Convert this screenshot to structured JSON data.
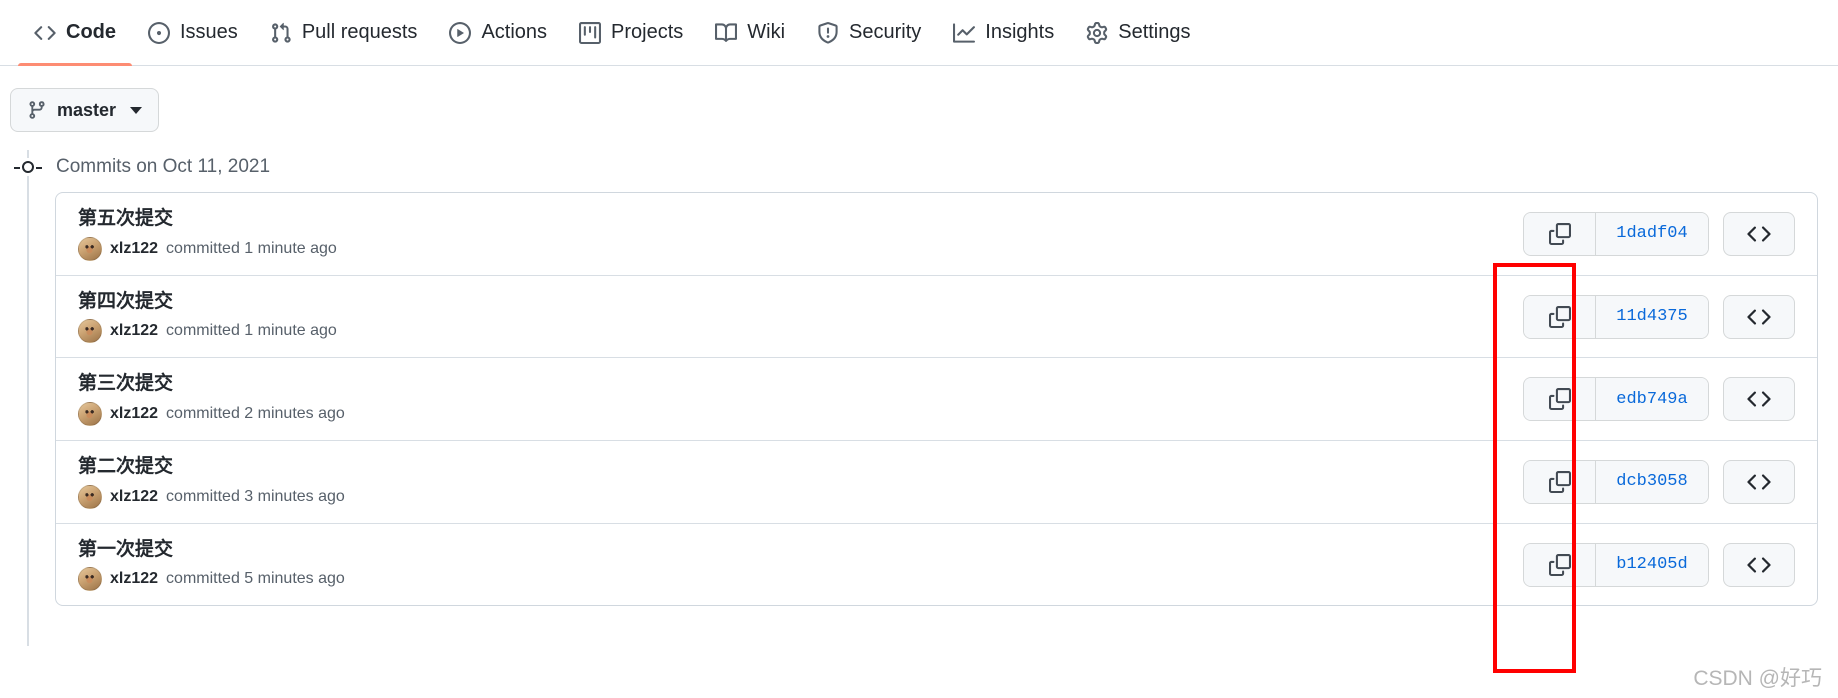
{
  "repo_nav": {
    "items": [
      {
        "label": "Code",
        "icon": "code-icon",
        "selected": true
      },
      {
        "label": "Issues",
        "icon": "issue-opened-icon",
        "selected": false
      },
      {
        "label": "Pull requests",
        "icon": "git-pull-request-icon",
        "selected": false
      },
      {
        "label": "Actions",
        "icon": "play-icon",
        "selected": false
      },
      {
        "label": "Projects",
        "icon": "project-icon",
        "selected": false
      },
      {
        "label": "Wiki",
        "icon": "book-icon",
        "selected": false
      },
      {
        "label": "Security",
        "icon": "shield-icon",
        "selected": false
      },
      {
        "label": "Insights",
        "icon": "graph-icon",
        "selected": false
      },
      {
        "label": "Settings",
        "icon": "gear-icon",
        "selected": false
      }
    ]
  },
  "branch_selector": {
    "label": "master",
    "icon": "git-branch-icon",
    "caret": "chevron-down-icon"
  },
  "commits": {
    "date_header": "Commits on Oct 11, 2021",
    "copy_icon": "copy-icon",
    "code_icon": "code-brackets-icon",
    "rows": [
      {
        "title": "第五次提交",
        "author": "xlz122",
        "meta_suffix": "committed 1 minute ago",
        "sha": "1dadf04"
      },
      {
        "title": "第四次提交",
        "author": "xlz122",
        "meta_suffix": "committed 1 minute ago",
        "sha": "11d4375"
      },
      {
        "title": "第三次提交",
        "author": "xlz122",
        "meta_suffix": "committed 2 minutes ago",
        "sha": "edb749a"
      },
      {
        "title": "第二次提交",
        "author": "xlz122",
        "meta_suffix": "committed 3 minutes ago",
        "sha": "dcb3058"
      },
      {
        "title": "第一次提交",
        "author": "xlz122",
        "meta_suffix": "committed 5 minutes ago",
        "sha": "b12405d"
      }
    ]
  },
  "annotation": {
    "color": "#ff0000",
    "target": "copy-sha-buttons-column"
  },
  "watermark": {
    "text": "CSDN @好巧"
  }
}
